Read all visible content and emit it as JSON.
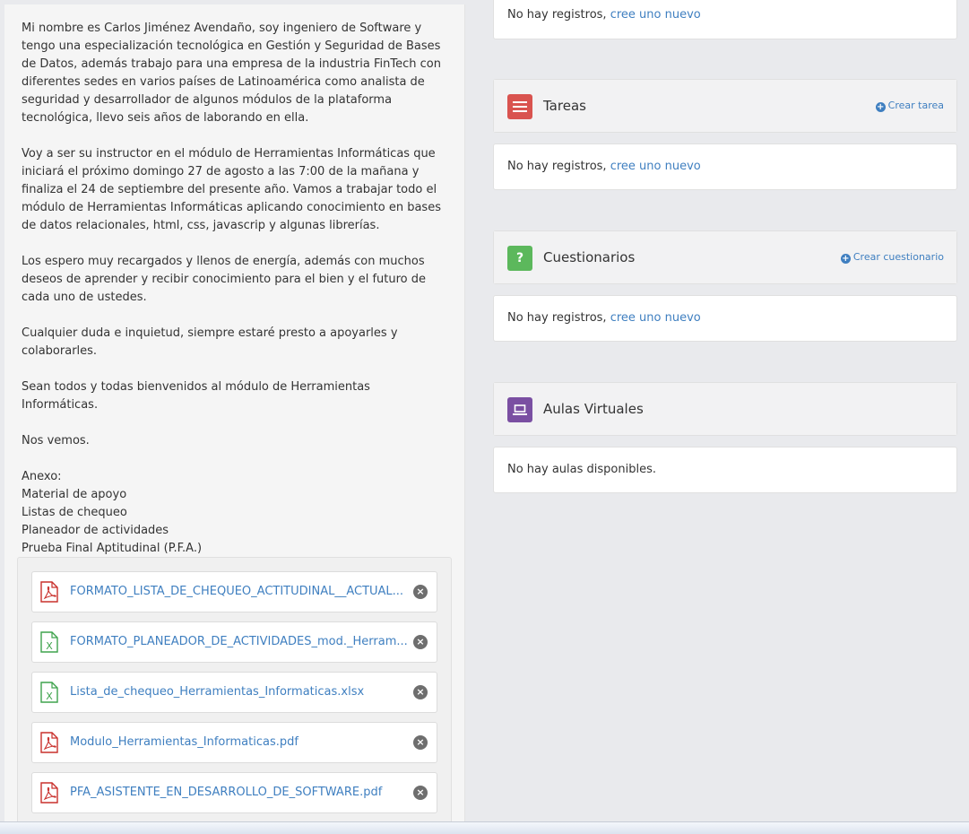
{
  "intro": {
    "paragraph1": "Mi nombre es Carlos Jiménez Avendaño, soy ingeniero de Software y tengo una especialización tecnológica en Gestión y Seguridad de Bases de Datos, además trabajo para una empresa de la industria FinTech con diferentes sedes en varios países de Latinoamérica como analista de seguridad y desarrollador de algunos módulos de la plataforma tecnológica, llevo seis años de laborando en ella.",
    "paragraph2": "Voy a ser su instructor en el módulo de Herramientas Informáticas que iniciará el próximo domingo 27 de agosto a las 7:00 de la mañana y finaliza el 24 de septiembre del presente año. Vamos a trabajar todo el módulo de Herramientas Informáticas aplicando conocimiento en bases de datos relacionales, html, css, javascrip y algunas librerías.",
    "paragraph3": "Los espero muy recargados y llenos de energía, además con muchos deseos de aprender y recibir conocimiento para el bien y el futuro de cada uno de ustedes.",
    "paragraph4": "Cualquier duda e inquietud, siempre estaré presto a apoyarles y colaborarles.",
    "paragraph5": "Sean todos y todas bienvenidos al módulo de Herramientas Informáticas.",
    "paragraph6": "Nos vemos.",
    "annex_title": "Anexo:",
    "annex_items": [
      "Material de apoyo",
      "Listas de chequeo",
      "Planeador de actividades",
      "Prueba Final Aptitudinal (P.F.A.)"
    ]
  },
  "files": [
    {
      "name": "FORMATO_LISTA_DE_CHEQUEO_ACTITUDINAL__ACTUAL...",
      "type": "pdf-icon"
    },
    {
      "name": "FORMATO_PLANEADOR_DE_ACTIVIDADES_mod._Herram...",
      "type": "excel-icon"
    },
    {
      "name": "Lista_de_chequeo_Herramientas_Informaticas.xlsx",
      "type": "excel-icon"
    },
    {
      "name": "Modulo_Herramientas_Informaticas.pdf",
      "type": "pdf-icon"
    },
    {
      "name": "PFA_ASISTENTE_EN_DESARROLLO_DE_SOFTWARE.pdf",
      "type": "pdf-icon"
    }
  ],
  "top_panel": {
    "empty_text": "No hay registros,",
    "empty_link": "cree uno nuevo"
  },
  "tareas": {
    "title": "Tareas",
    "action": "Crear tarea",
    "empty_text": "No hay registros,",
    "empty_link": "cree uno nuevo",
    "icon_color": "#d9534f"
  },
  "cuestionarios": {
    "title": "Cuestionarios",
    "icon_glyph": "?",
    "action": "Crear cuestionario",
    "empty_text": "No hay registros,",
    "empty_link": "cree uno nuevo",
    "icon_color": "#5cb85c"
  },
  "aulas": {
    "title": "Aulas Virtuales",
    "empty_text": "No hay aulas disponibles.",
    "icon_color": "#7a4fa2"
  },
  "colors": {
    "link": "#3f7fc0",
    "pdf": "#c9302c",
    "excel": "#3fa34d"
  }
}
